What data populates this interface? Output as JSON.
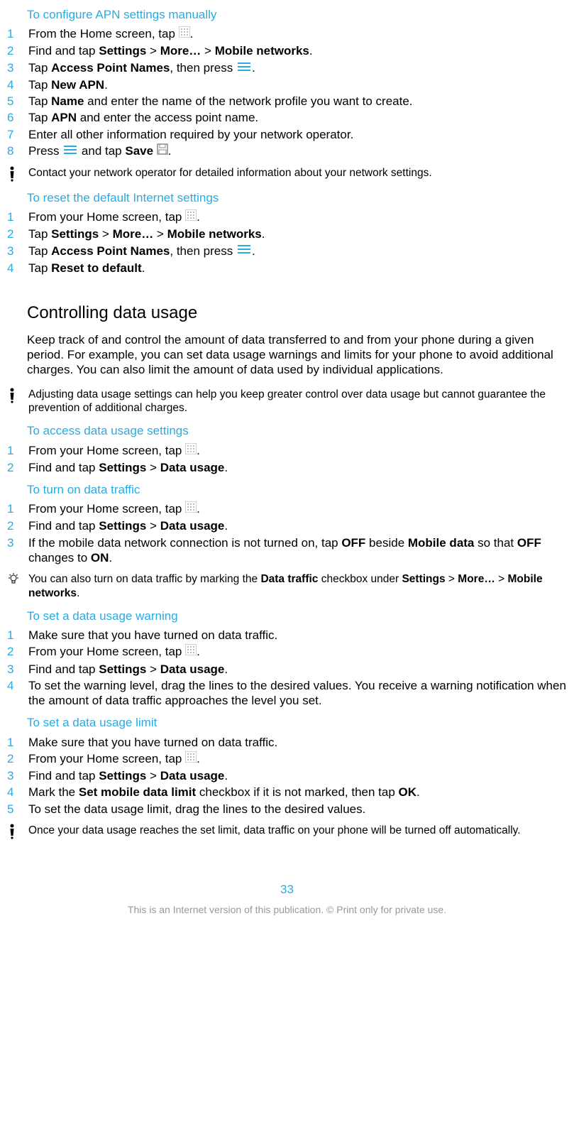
{
  "colors": {
    "accent": "#29abe2"
  },
  "sec_apn": {
    "title": "To configure APN settings manually",
    "steps": [
      {
        "pre": "From the Home screen, tap ",
        "post": "."
      },
      {
        "parts": [
          "Find and tap ",
          "Settings",
          " > ",
          "More…",
          " > ",
          "Mobile networks",
          "."
        ]
      },
      {
        "parts": [
          "Tap ",
          "Access Point Names",
          ", then press "
        ],
        "post": "."
      },
      {
        "parts": [
          "Tap ",
          "New APN",
          "."
        ]
      },
      {
        "parts": [
          "Tap ",
          "Name",
          " and enter the name of the network profile you want to create."
        ]
      },
      {
        "parts": [
          "Tap ",
          "APN",
          " and enter the access point name."
        ]
      },
      {
        "text": "Enter all other information required by your network operator."
      },
      {
        "parts": [
          "Press "
        ],
        "mid": " and tap ",
        "bold2": "Save",
        "post2": " ",
        "end": "."
      }
    ],
    "note": "Contact your network operator for detailed information about your network settings."
  },
  "sec_reset": {
    "title": "To reset the default Internet settings",
    "steps": [
      {
        "pre": "From your Home screen, tap ",
        "post": "."
      },
      {
        "parts": [
          "Tap ",
          "Settings",
          " > ",
          "More…",
          " > ",
          "Mobile networks",
          "."
        ]
      },
      {
        "parts": [
          "Tap ",
          "Access Point Names",
          ", then press "
        ],
        "post": "."
      },
      {
        "parts": [
          "Tap ",
          "Reset to default",
          "."
        ]
      }
    ]
  },
  "sec_control": {
    "heading": "Controlling data usage",
    "para": "Keep track of and control the amount of data transferred to and from your phone during a given period. For example, you can set data usage warnings and limits for your phone to avoid additional charges. You can also limit the amount of data used by individual applications.",
    "note": "Adjusting data usage settings can help you keep greater control over data usage but cannot guarantee the prevention of additional charges."
  },
  "sec_access": {
    "title": "To access data usage settings",
    "steps": [
      {
        "pre": "From your Home screen, tap ",
        "post": "."
      },
      {
        "parts": [
          "Find and tap ",
          "Settings",
          " > ",
          "Data usage",
          "."
        ]
      }
    ]
  },
  "sec_turnon": {
    "title": "To turn on data traffic",
    "steps": [
      {
        "pre": "From your Home screen, tap ",
        "post": "."
      },
      {
        "parts": [
          "Find and tap ",
          "Settings",
          " > ",
          "Data usage",
          "."
        ]
      },
      {
        "parts": [
          "If the mobile data network connection is not turned on, tap ",
          "OFF",
          " beside ",
          "Mobile data",
          " so that ",
          "OFF",
          " changes to ",
          "ON",
          "."
        ]
      }
    ],
    "tip_parts": [
      "You can also turn on data traffic by marking the ",
      "Data traffic",
      " checkbox under ",
      "Settings",
      " > ",
      "More…",
      " > ",
      "Mobile networks",
      "."
    ]
  },
  "sec_warning": {
    "title": "To set a data usage warning",
    "steps": [
      {
        "text": "Make sure that you have turned on data traffic."
      },
      {
        "pre": "From your Home screen, tap ",
        "post": "."
      },
      {
        "parts": [
          "Find and tap ",
          "Settings",
          " > ",
          "Data usage",
          "."
        ]
      },
      {
        "text": "To set the warning level, drag the lines to the desired values. You receive a warning notification when the amount of data traffic approaches the level you set."
      }
    ]
  },
  "sec_limit": {
    "title": "To set a data usage limit",
    "steps": [
      {
        "text": "Make sure that you have turned on data traffic."
      },
      {
        "pre": "From your Home screen, tap ",
        "post": "."
      },
      {
        "parts": [
          "Find and tap ",
          "Settings",
          " > ",
          "Data usage",
          "."
        ]
      },
      {
        "parts": [
          "Mark the ",
          "Set mobile data limit",
          " checkbox if it is not marked, then tap ",
          "OK",
          "."
        ]
      },
      {
        "text": "To set the data usage limit, drag the lines to the desired values."
      }
    ],
    "note": "Once your data usage reaches the set limit, data traffic on your phone will be turned off automatically."
  },
  "page_number": "33",
  "footer": "This is an Internet version of this publication. © Print only for private use."
}
